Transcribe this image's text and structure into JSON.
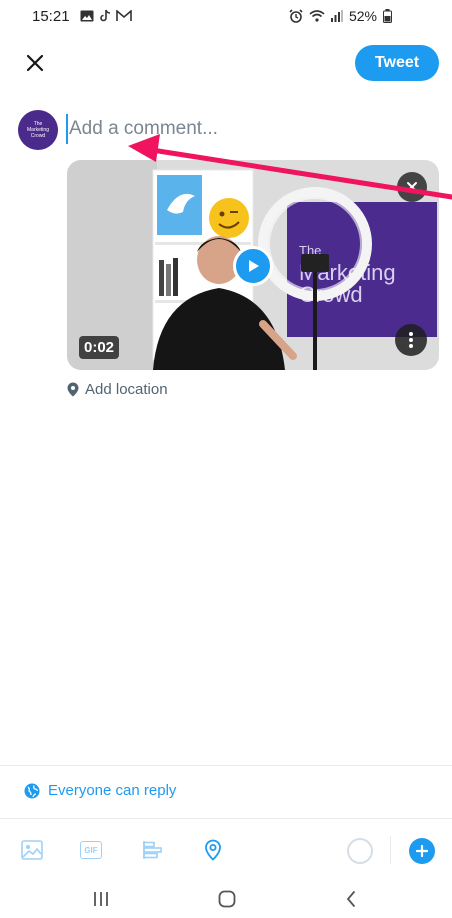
{
  "status_bar": {
    "time": "15:21",
    "battery": "52%"
  },
  "header": {
    "tweet_label": "Tweet"
  },
  "compose": {
    "avatar_text": [
      "The",
      "Marketing",
      "Crowd"
    ],
    "placeholder": "Add a comment..."
  },
  "media": {
    "duration": "0:02",
    "poster_text": [
      "The",
      "Marketing",
      "Crowd"
    ]
  },
  "location": {
    "label": "Add location"
  },
  "reply_setting": {
    "label": "Everyone can reply"
  },
  "toolbar": {
    "gif_label": "GIF",
    "icons": [
      "image-icon",
      "gif-icon",
      "poll-icon",
      "location-icon",
      "character-counter",
      "add-thread-icon"
    ]
  },
  "colors": {
    "accent": "#1d9bf0",
    "annotation_arrow": "#f0135f"
  }
}
